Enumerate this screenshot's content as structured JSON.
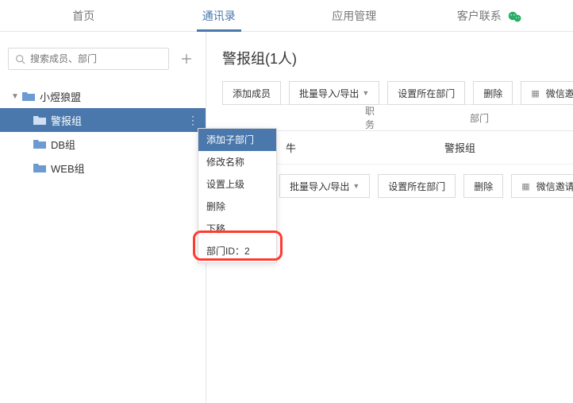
{
  "nav": {
    "tabs": [
      "首页",
      "通讯录",
      "应用管理",
      "客户联系"
    ],
    "active_index": 1
  },
  "search": {
    "placeholder": "搜索成员、部门"
  },
  "tree": {
    "root": "小煜狼盟",
    "children": [
      {
        "label": "警报组",
        "selected": true
      },
      {
        "label": "DB组",
        "selected": false
      },
      {
        "label": "WEB组",
        "selected": false
      }
    ]
  },
  "content": {
    "title": "警报组(1人)",
    "toolbar": {
      "add_member": "添加成员",
      "batch": "批量导入/导出",
      "set_dept": "设置所在部门",
      "delete": "删除",
      "wechat_invite": "微信邀请"
    },
    "table": {
      "headers": {
        "job": "职务",
        "dept": "部门"
      },
      "rows": [
        {
          "name_tail": "牛",
          "dept": "警报组"
        }
      ]
    }
  },
  "context_menu": {
    "items": [
      "添加子部门",
      "修改名称",
      "设置上级",
      "删除",
      "下移"
    ],
    "dept_id_label": "部门ID：",
    "dept_id_value": "2",
    "highlight_index": 0
  },
  "colors": {
    "accent": "#4a77ac",
    "highlight_red": "#ff3b30"
  }
}
